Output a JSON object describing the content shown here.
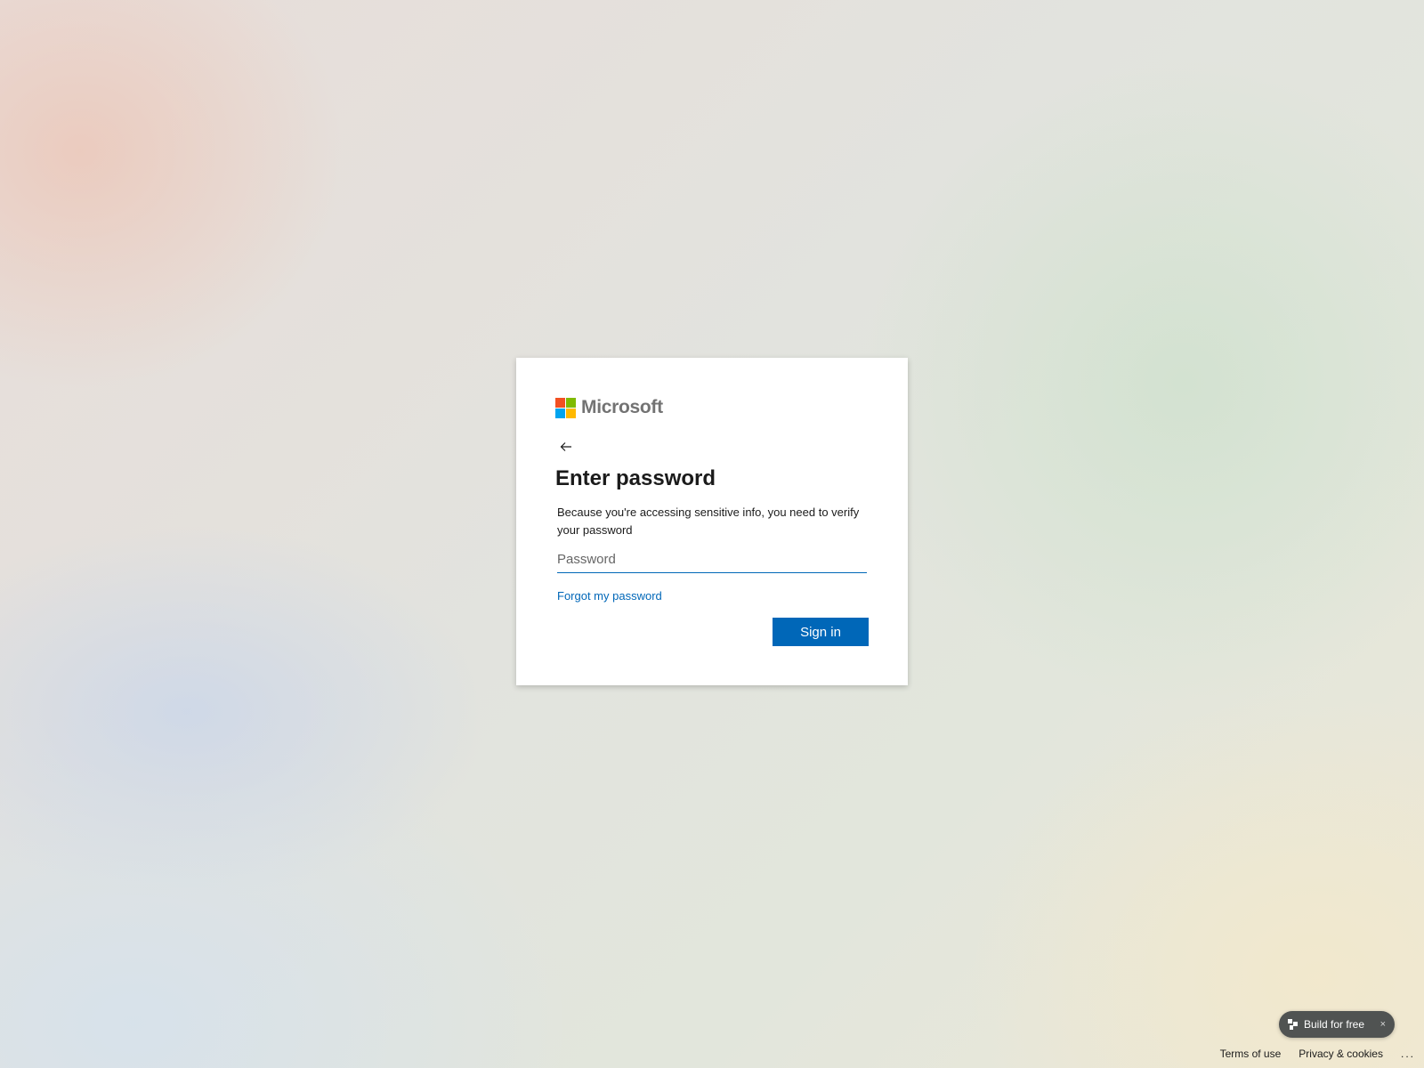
{
  "brand": {
    "name": "Microsoft",
    "logo_colors": [
      "#f25022",
      "#7fba00",
      "#00a4ef",
      "#ffb900"
    ]
  },
  "card": {
    "back_icon": "arrow-left-icon",
    "title": "Enter password",
    "description": "Because you're accessing sensitive info, you need to verify your password",
    "password_placeholder": "Password",
    "password_value": "",
    "forgot_link": "Forgot my password",
    "signin_label": "Sign in",
    "accent_color": "#0067b8"
  },
  "promo": {
    "label": "Build for free",
    "close_glyph": "×"
  },
  "footer": {
    "terms": "Terms of use",
    "privacy": "Privacy & cookies",
    "more": "..."
  }
}
